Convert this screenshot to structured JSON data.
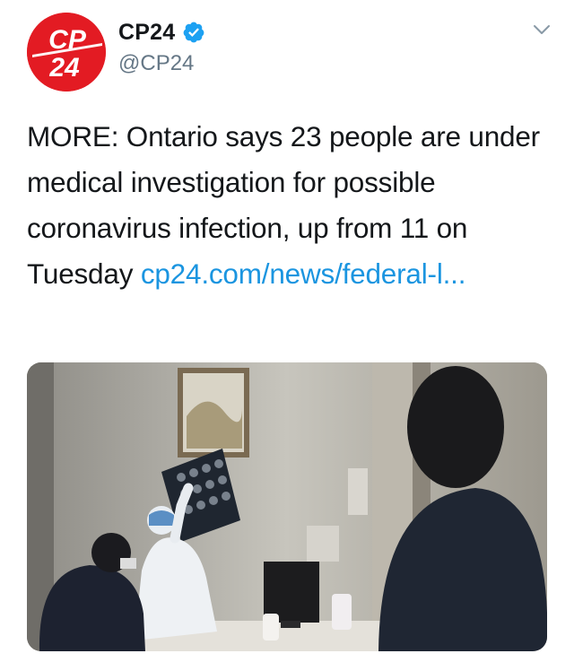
{
  "tweet": {
    "avatar": {
      "lines": [
        "CP",
        "24"
      ],
      "color": "#e31b23"
    },
    "display_name": "CP24",
    "verified_icon": "verified-badge-icon",
    "handle": "@CP24",
    "menu_icon": "chevron-down-icon",
    "text": "MORE: Ontario says 23 people are under medical investigation for possible coronavirus infection, up from 11 on Tuesday",
    "link_text": "cp24.com/news/federal-l...",
    "link_color": "#1b95e0",
    "media_description": "",
    "accent_color": "#1da1f2"
  }
}
